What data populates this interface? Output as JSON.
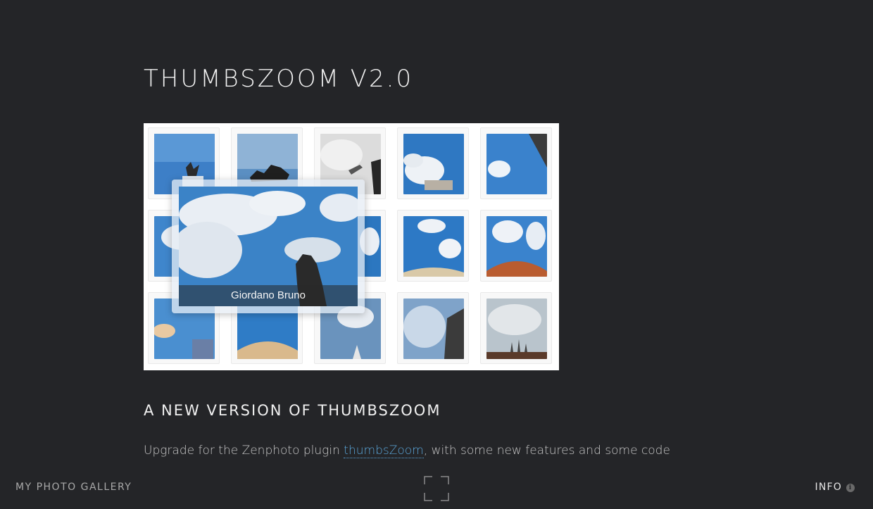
{
  "page": {
    "title": "THUMBSZOOM V2.0"
  },
  "demo": {
    "caption": "Giordano Bruno"
  },
  "article": {
    "heading": "A NEW VERSION OF THUMBSZOOM",
    "intro_before": "Upgrade for the Zenphoto plugin ",
    "intro_link": "thumbsZoom",
    "intro_after": ", with some new features and some code"
  },
  "footer": {
    "brand": "MY PHOTO GALLERY",
    "info_label": "INFO",
    "fullscreen_icon": "fullscreen-icon",
    "info_icon": "info-circle-icon"
  },
  "colors": {
    "background": "#242528",
    "link": "#5aa5d8",
    "text": "#e8e8e8"
  }
}
